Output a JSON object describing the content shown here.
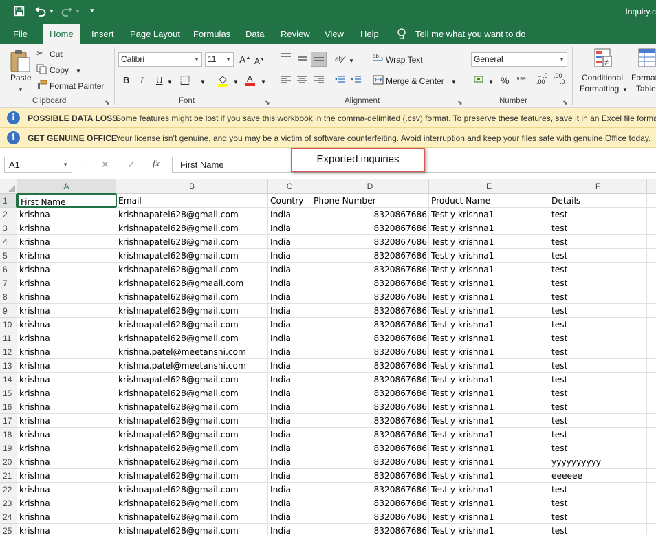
{
  "title_bar": {
    "doc_title": "Inquiry.c"
  },
  "qat": {
    "save_icon": "save-icon",
    "undo_icon": "undo-icon",
    "redo_icon": "redo-icon",
    "customize_icon": "customize-qat-icon"
  },
  "tabs": [
    "File",
    "Home",
    "Insert",
    "Page Layout",
    "Formulas",
    "Data",
    "Review",
    "View",
    "Help"
  ],
  "tell_me": "Tell me what you want to do",
  "ribbon": {
    "clipboard": {
      "paste": "Paste",
      "cut": "Cut",
      "copy": "Copy",
      "format_painter": "Format Painter",
      "label": "Clipboard"
    },
    "font": {
      "name": "Calibri",
      "size": "11",
      "bold": "B",
      "italic": "I",
      "underline": "U",
      "label": "Font"
    },
    "alignment": {
      "wrap_text": "Wrap Text",
      "merge_center": "Merge & Center",
      "label": "Alignment"
    },
    "number": {
      "format": "General",
      "percent": "%",
      "label": "Number"
    },
    "styles": {
      "conditional": "Conditional",
      "formatting": "Formatting",
      "format_as": "Format",
      "table": "Table"
    }
  },
  "messages": [
    {
      "title": "POSSIBLE DATA LOSS",
      "text": "Some features might be lost if you save this workbook in the comma-delimited (.csv) format. To preserve these features, save it in an Excel file format."
    },
    {
      "title": "GET GENUINE OFFICE",
      "text": "Your license isn't genuine, and you may be a victim of software counterfeiting. Avoid interruption and keep your files safe with genuine Office today."
    }
  ],
  "formula_bar": {
    "name_box": "A1",
    "fx": "fx",
    "content": "First Name"
  },
  "callout": "Exported inquiries",
  "columns": [
    "A",
    "B",
    "C",
    "D",
    "E",
    "F"
  ],
  "header_row": [
    "First Name",
    "Email",
    "Country",
    "Phone Number",
    "Product Name",
    "Details"
  ],
  "rows": [
    [
      "krishna",
      "krishnapatel628@gmail.com",
      "India",
      "8320867686",
      "Test y krishna1",
      "test"
    ],
    [
      "krishna",
      "krishnapatel628@gmail.com",
      "India",
      "8320867686",
      "Test y krishna1",
      "test"
    ],
    [
      "krishna",
      "krishnapatel628@gmail.com",
      "India",
      "8320867686",
      "Test y krishna1",
      "test"
    ],
    [
      "krishna",
      "krishnapatel628@gmail.com",
      "India",
      "8320867686",
      "Test y krishna1",
      "test"
    ],
    [
      "krishna",
      "krishnapatel628@gmail.com",
      "India",
      "8320867686",
      "Test y krishna1",
      "test"
    ],
    [
      "krishna",
      "krishnapatel628@gmaail.com",
      "India",
      "8320867686",
      "Test y krishna1",
      "test"
    ],
    [
      "krishna",
      "krishnapatel628@gmail.com",
      "India",
      "8320867686",
      "Test y krishna1",
      "test"
    ],
    [
      "krishna",
      "krishnapatel628@gmail.com",
      "India",
      "8320867686",
      "Test y krishna1",
      "test"
    ],
    [
      "krishna",
      "krishnapatel628@gmail.com",
      "India",
      "8320867686",
      "Test y krishna1",
      "test"
    ],
    [
      "krishna",
      "krishnapatel628@gmail.com",
      "India",
      "8320867686",
      "Test y krishna1",
      "test"
    ],
    [
      "krishna",
      "krishna.patel@meetanshi.com",
      "India",
      "8320867686",
      "Test y krishna1",
      "test"
    ],
    [
      "krishna",
      "krishna.patel@meetanshi.com",
      "India",
      "8320867686",
      "Test y krishna1",
      "test"
    ],
    [
      "krishna",
      "krishnapatel628@gmail.com",
      "India",
      "8320867686",
      "Test y krishna1",
      "test"
    ],
    [
      "krishna",
      "krishnapatel628@gmail.com",
      "India",
      "8320867686",
      "Test y krishna1",
      "test"
    ],
    [
      "krishna",
      "krishnapatel628@gmail.com",
      "India",
      "8320867686",
      "Test y krishna1",
      "test"
    ],
    [
      "krishna",
      "krishnapatel628@gmail.com",
      "India",
      "8320867686",
      "Test y krishna1",
      "test"
    ],
    [
      "krishna",
      "krishnapatel628@gmail.com",
      "India",
      "8320867686",
      "Test y krishna1",
      "test"
    ],
    [
      "krishna",
      "krishnapatel628@gmail.com",
      "India",
      "8320867686",
      "Test y krishna1",
      "test"
    ],
    [
      "krishna",
      "krishnapatel628@gmail.com",
      "India",
      "8320867686",
      "Test y krishna1",
      "yyyyyyyyyy"
    ],
    [
      "krishna",
      "krishnapatel628@gmail.com",
      "India",
      "8320867686",
      "Test y krishna1",
      "eeeeee"
    ],
    [
      "krishna",
      "krishnapatel628@gmail.com",
      "India",
      "8320867686",
      "Test y krishna1",
      "test"
    ],
    [
      "krishna",
      "krishnapatel628@gmail.com",
      "India",
      "8320867686",
      "Test y krishna1",
      "test"
    ],
    [
      "krishna",
      "krishnapatel628@gmail.com",
      "India",
      "8320867686",
      "Test y krishna1",
      "test"
    ],
    [
      "krishna",
      "krishnapatel628@gmail.com",
      "India",
      "8320867686",
      "Test y krishna1",
      "test"
    ]
  ],
  "colors": {
    "excel_green": "#217346",
    "message_bar": "#fdf1c4",
    "callout_border": "#e05353"
  }
}
